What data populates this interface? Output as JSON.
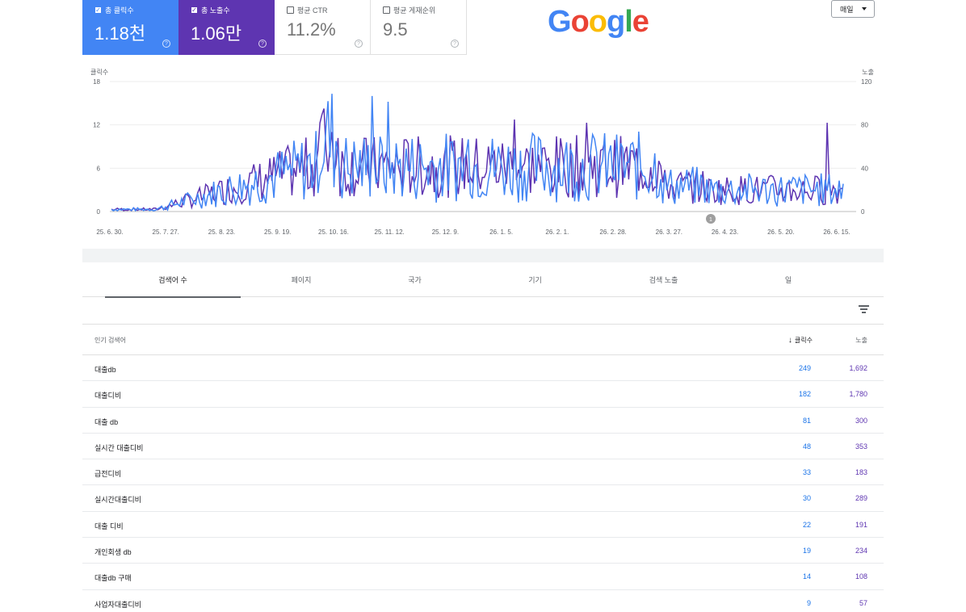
{
  "metrics": [
    {
      "label": "총 클릭수",
      "value": "1.18천",
      "checked": true
    },
    {
      "label": "총 노출수",
      "value": "1.06만",
      "checked": true
    },
    {
      "label": "평균 CTR",
      "value": "11.2%",
      "checked": false
    },
    {
      "label": "평균 게재순위",
      "value": "9.5",
      "checked": false
    }
  ],
  "logo": {
    "letters": [
      "G",
      "o",
      "o",
      "g",
      "l",
      "e"
    ]
  },
  "period": {
    "label": "매일"
  },
  "chart_data": {
    "type": "line",
    "left_axis": {
      "label": "클릭수",
      "ticks": [
        0,
        6,
        12,
        18
      ],
      "range": [
        0,
        18
      ]
    },
    "right_axis": {
      "label": "노출",
      "ticks": [
        0,
        40,
        80,
        120
      ],
      "range": [
        0,
        120
      ]
    },
    "x_tick_labels": [
      "25. 6. 30.",
      "25. 7. 27.",
      "25. 8. 23.",
      "25. 9. 19.",
      "25. 10. 16.",
      "25. 11. 12.",
      "25. 12. 9.",
      "26. 1. 5.",
      "26. 2. 1.",
      "26. 2. 28.",
      "26. 3. 27.",
      "26. 4. 23.",
      "26. 5. 20.",
      "26. 6. 15."
    ],
    "annotation": "1",
    "series": [
      {
        "name": "클릭수",
        "color": "#4285f4",
        "axis": "left"
      },
      {
        "name": "노출",
        "color": "#5e35b1",
        "axis": "right"
      }
    ]
  },
  "tabs": [
    "검색어 수",
    "페이지",
    "국가",
    "기기",
    "검색 노출",
    "일"
  ],
  "table": {
    "headers": {
      "query": "인기 검색어",
      "clicks": "클릭수",
      "impressions": "노출"
    },
    "rows": [
      {
        "query": "대출db",
        "clicks": "249",
        "impressions": "1,692"
      },
      {
        "query": "대출디비",
        "clicks": "182",
        "impressions": "1,780"
      },
      {
        "query": "대출 db",
        "clicks": "81",
        "impressions": "300"
      },
      {
        "query": "실시간 대출디비",
        "clicks": "48",
        "impressions": "353"
      },
      {
        "query": "급전디비",
        "clicks": "33",
        "impressions": "183"
      },
      {
        "query": "실시간대출디비",
        "clicks": "30",
        "impressions": "289"
      },
      {
        "query": "대출 디비",
        "clicks": "22",
        "impressions": "191"
      },
      {
        "query": "개인회생 db",
        "clicks": "19",
        "impressions": "234"
      },
      {
        "query": "대출db 구매",
        "clicks": "14",
        "impressions": "108"
      },
      {
        "query": "사업자대출디비",
        "clicks": "9",
        "impressions": "57"
      }
    ]
  },
  "colors": {
    "clicks": "#4285f4",
    "impressions": "#5e35b1"
  }
}
